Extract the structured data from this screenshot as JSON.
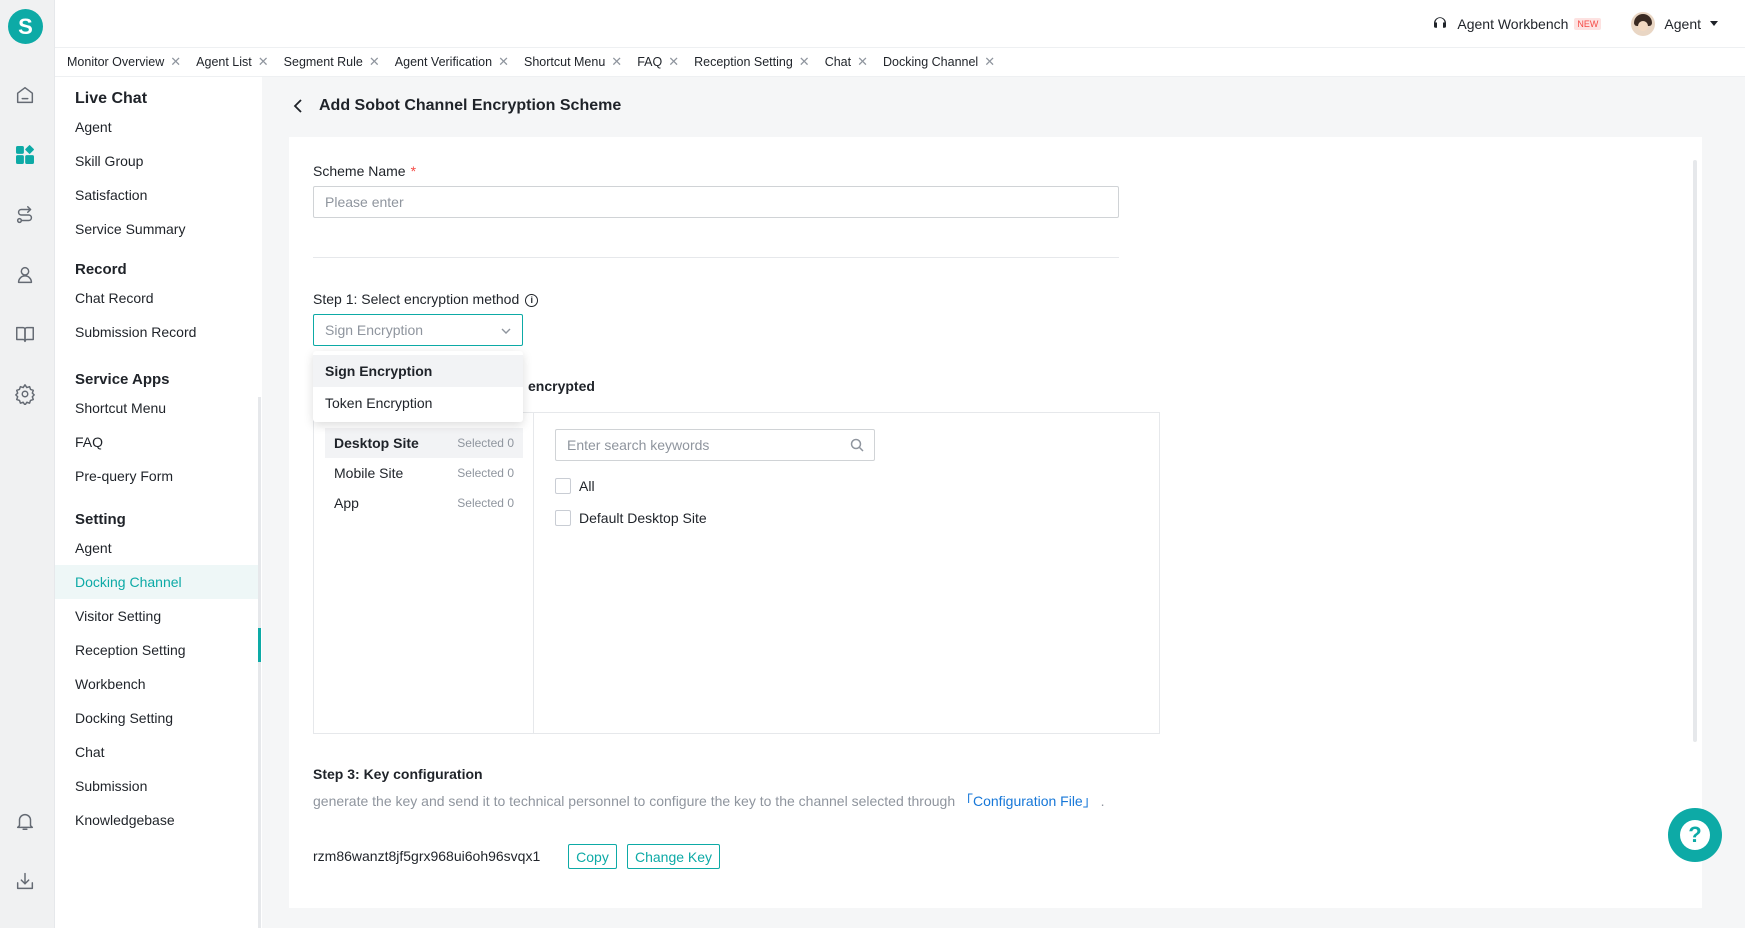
{
  "app": {
    "logo_letter": "S"
  },
  "rail": {
    "icons": [
      "home-icon",
      "dashboard-icon",
      "route-icon",
      "user-icon",
      "book-icon",
      "gear-icon",
      "bell-icon",
      "download-icon"
    ]
  },
  "header": {
    "workbench": "Agent Workbench",
    "workbench_badge": "NEW",
    "user": "Agent"
  },
  "tabs": [
    "Monitor Overview",
    "Agent List",
    "Segment Rule",
    "Agent Verification",
    "Shortcut Menu",
    "FAQ",
    "Reception Setting",
    "Chat",
    "Docking Channel"
  ],
  "sidebar": {
    "live_chat": {
      "title": "Live Chat",
      "items": [
        "Agent",
        "Skill Group",
        "Satisfaction",
        "Service Summary"
      ]
    },
    "record": {
      "title": "Record",
      "items": [
        "Chat Record",
        "Submission Record"
      ]
    },
    "service_apps": {
      "title": "Service Apps",
      "items": [
        "Shortcut Menu",
        "FAQ",
        "Pre-query Form"
      ]
    },
    "setting": {
      "title": "Setting",
      "items": [
        "Agent",
        "Docking Channel",
        "Visitor Setting",
        "Reception Setting",
        "Workbench",
        "Docking Setting",
        "Chat",
        "Submission",
        "Knowledgebase"
      ],
      "active": "Docking Channel"
    }
  },
  "page": {
    "title": "Add Sobot Channel Encryption Scheme",
    "scheme_name_label": "Scheme Name",
    "required_mark": "*",
    "scheme_name_placeholder": "Please enter",
    "step1_label": "Step 1: Select encryption method",
    "step1_selected": "Sign Encryption",
    "step1_options": [
      "Sign Encryption",
      "Token Encryption"
    ],
    "step2_label_visible": "encrypted",
    "sites": [
      {
        "name": "Desktop Site",
        "count": "Selected 0"
      },
      {
        "name": "Mobile Site",
        "count": "Selected 0"
      },
      {
        "name": "App",
        "count": "Selected 0"
      }
    ],
    "search_placeholder": "Enter search keywords",
    "checkbox_all": "All",
    "checkbox_default": "Default Desktop Site",
    "step3_label": "Step 3: Key configuration",
    "step3_desc": "generate the key and send it to technical personnel to configure the key to the channel selected through",
    "step3_link": "「Configuration File」",
    "step3_desc_end": ".",
    "key_value": "rzm86wanzt8jf5grx968ui6oh96svqx1",
    "copy_label": "Copy",
    "change_key_label": "Change Key"
  },
  "help": {
    "label": "?"
  },
  "colors": {
    "accent": "#0daaa6",
    "link": "#1677d8",
    "danger": "#f54a45"
  }
}
